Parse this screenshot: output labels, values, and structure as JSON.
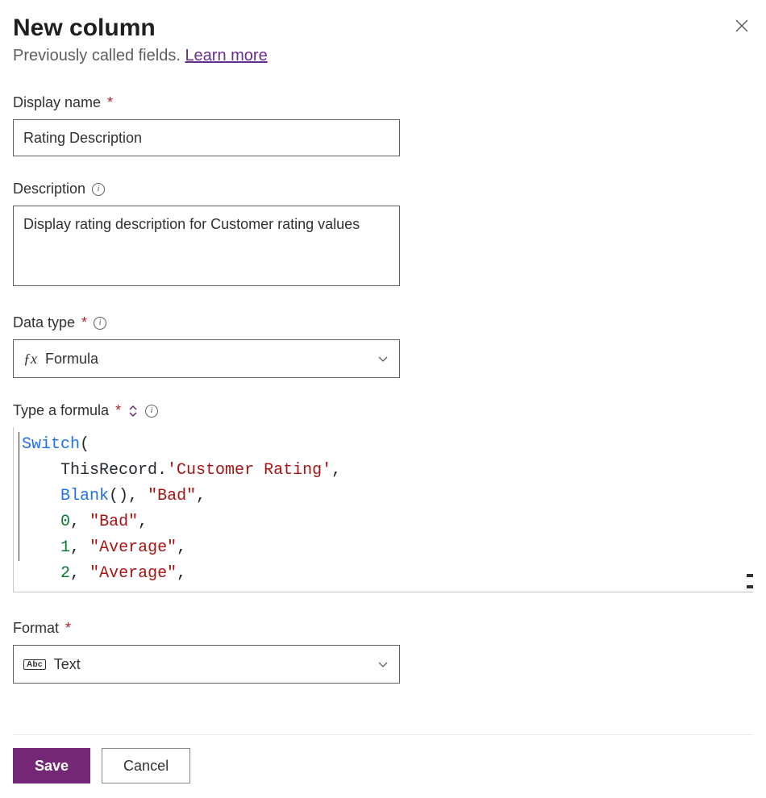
{
  "header": {
    "title": "New column",
    "subtitle_prefix": "Previously called fields. ",
    "learn_more": "Learn more"
  },
  "display_name": {
    "label": "Display name",
    "value": "Rating Description"
  },
  "description": {
    "label": "Description",
    "value": "Display rating description for Customer rating values"
  },
  "data_type": {
    "label": "Data type",
    "selected": "Formula"
  },
  "formula": {
    "label": "Type a formula",
    "tokens_html": "<span class=\"tok-fn\">Switch</span><span class=\"tok-punc\">(</span>\n    <span class=\"tok-id\">ThisRecord.</span><span class=\"tok-str\">'Customer Rating'</span><span class=\"tok-punc\">,</span>\n    <span class=\"tok-fn\">Blank</span><span class=\"tok-punc\">(),</span> <span class=\"tok-str\">\"Bad\"</span><span class=\"tok-punc\">,</span>\n    <span class=\"tok-num\">0</span><span class=\"tok-punc\">,</span> <span class=\"tok-str\">\"Bad\"</span><span class=\"tok-punc\">,</span>\n    <span class=\"tok-num\">1</span><span class=\"tok-punc\">,</span> <span class=\"tok-str\">\"Average\"</span><span class=\"tok-punc\">,</span>\n    <span class=\"tok-num\">2</span><span class=\"tok-punc\">,</span> <span class=\"tok-str\">\"Average\"</span><span class=\"tok-punc\">,</span>"
  },
  "format": {
    "label": "Format",
    "selected": "Text"
  },
  "footer": {
    "save": "Save",
    "cancel": "Cancel"
  }
}
